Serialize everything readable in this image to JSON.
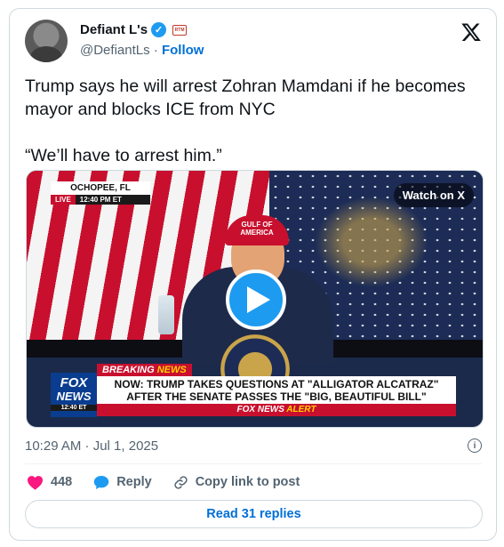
{
  "author": {
    "display_name": "Defiant L's",
    "handle": "@DefiantLs",
    "separator": "·",
    "follow_label": "Follow",
    "verified_glyph": "✓",
    "affiliation_badge": "RTM"
  },
  "tweet": {
    "line1": "Trump says he will arrest Zohran Mamdani if he becomes mayor and blocks ICE from NYC",
    "line2": "“We’ll have to arrest him.”"
  },
  "media": {
    "watch_label": "Watch on X",
    "location": "OCHOPEE, FL",
    "live_label": "LIVE",
    "location_time": "12:40 PM ET",
    "cap_text": "GULF OF AMERICA",
    "breaking_word1": "BREAKING",
    "breaking_word2": "NEWS",
    "headline": "NOW: TRUMP TAKES QUESTIONS AT \"ALLIGATOR ALCATRAZ\" AFTER THE SENATE PASSES THE \"BIG, BEAUTIFUL BILL\"",
    "fox_line1": "FOX",
    "fox_line2": "NEWS",
    "fox_time": "12:40 ET",
    "alert_prefix": "FOX NEWS",
    "alert_word": "ALERT"
  },
  "meta": {
    "timestamp": "10:29 AM · Jul 1, 2025",
    "info_glyph": "i"
  },
  "actions": {
    "like_count": "448",
    "reply_label": "Reply",
    "copy_label": "Copy link to post"
  },
  "read_replies_label": "Read 31 replies",
  "colors": {
    "accent": "#1d9bf0",
    "link": "#006fd6",
    "like": "#f91880",
    "muted": "#536471"
  }
}
